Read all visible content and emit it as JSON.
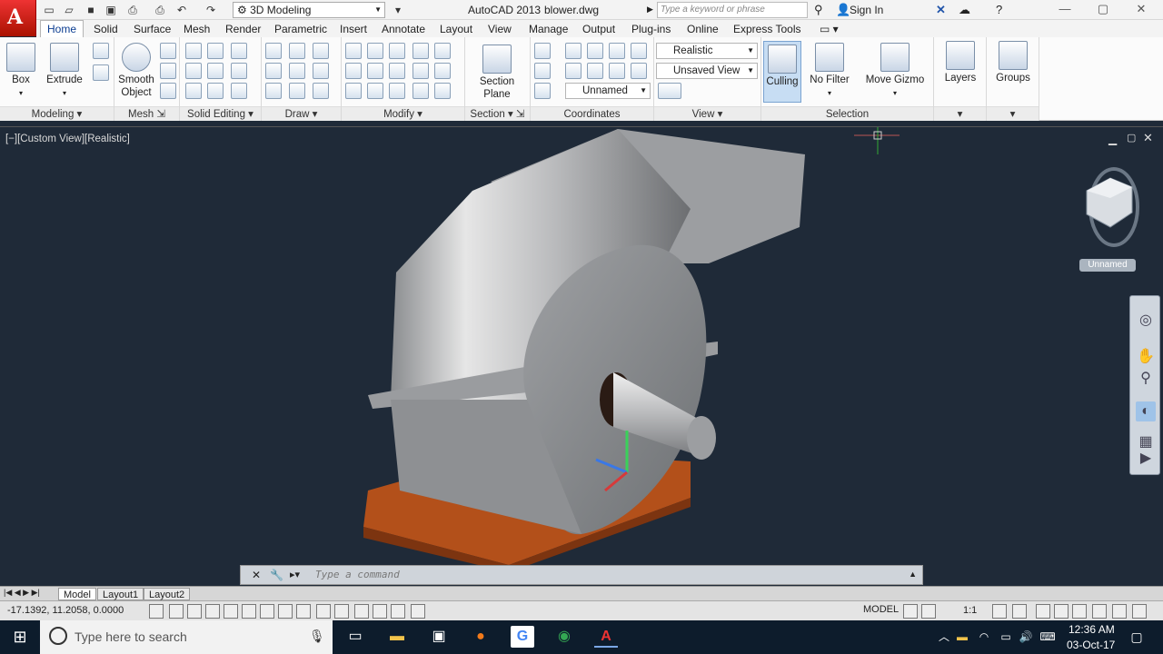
{
  "titlebar": {
    "app_title": "AutoCAD 2013",
    "file_name": "blower.dwg",
    "workspace": "3D Modeling",
    "search_placeholder": "Type a keyword or phrase",
    "sign_in": "Sign In"
  },
  "tabs": [
    "Home",
    "Solid",
    "Surface",
    "Mesh",
    "Render",
    "Parametric",
    "Insert",
    "Annotate",
    "Layout",
    "View",
    "Manage",
    "Output",
    "Plug-ins",
    "Online",
    "Express Tools"
  ],
  "ribbon": {
    "panels": {
      "modeling": "Modeling",
      "mesh": "Mesh",
      "solid_editing": "Solid Editing",
      "draw": "Draw",
      "modify": "Modify",
      "section": "Section",
      "coordinates": "Coordinates",
      "view": "View",
      "selection": "Selection"
    },
    "buttons": {
      "box": "Box",
      "extrude": "Extrude",
      "smooth_object_1": "Smooth",
      "smooth_object_2": "Object",
      "section_plane_1": "Section",
      "section_plane_2": "Plane",
      "culling": "Culling",
      "no_filter": "No Filter",
      "move_gizmo": "Move Gizmo",
      "layers": "Layers",
      "groups": "Groups"
    },
    "combos": {
      "visual_style": "Realistic",
      "named_view": "Unsaved View",
      "ucs": "Unnamed"
    }
  },
  "viewport": {
    "label": "[−][Custom View][Realistic]",
    "viewcube_label": "Unnamed"
  },
  "command": {
    "placeholder": "Type a command"
  },
  "layout_tabs": [
    "Model",
    "Layout1",
    "Layout2"
  ],
  "statusbar": {
    "coords": "-17.1392, 11.2058, 0.0000",
    "model": "MODEL",
    "scale": "1:1"
  },
  "taskbar": {
    "search_placeholder": "Type here to search",
    "time": "12:36 AM",
    "date": "03-Oct-17"
  }
}
